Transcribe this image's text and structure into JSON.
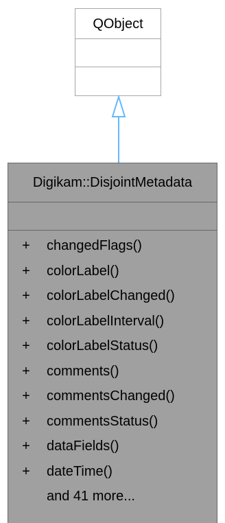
{
  "base_class": {
    "name": "QObject"
  },
  "derived_class": {
    "name": "Digikam::DisjointMetadata",
    "methods": [
      {
        "visibility": "+",
        "name": "changedFlags()"
      },
      {
        "visibility": "+",
        "name": "colorLabel()"
      },
      {
        "visibility": "+",
        "name": "colorLabelChanged()"
      },
      {
        "visibility": "+",
        "name": "colorLabelInterval()"
      },
      {
        "visibility": "+",
        "name": "colorLabelStatus()"
      },
      {
        "visibility": "+",
        "name": "comments()"
      },
      {
        "visibility": "+",
        "name": "commentsChanged()"
      },
      {
        "visibility": "+",
        "name": "commentsStatus()"
      },
      {
        "visibility": "+",
        "name": "dataFields()"
      },
      {
        "visibility": "+",
        "name": "dateTime()"
      }
    ],
    "more_text": "and 41 more..."
  },
  "colors": {
    "arrow": "#63b8ff",
    "derived_fill": "#a0a0a0",
    "derived_border": "#676767",
    "base_border": "#a6a6a6"
  }
}
